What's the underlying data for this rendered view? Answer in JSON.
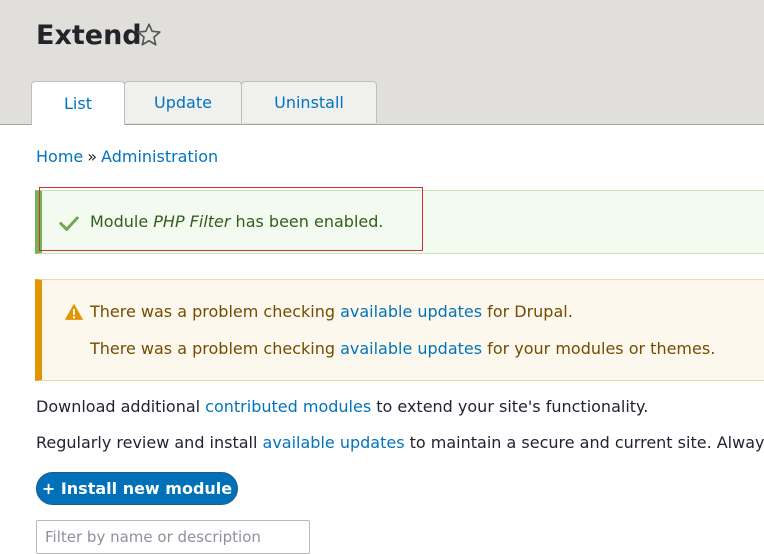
{
  "header": {
    "title": "Extend",
    "tabs": [
      {
        "label": "List"
      },
      {
        "label": "Update"
      },
      {
        "label": "Uninstall"
      }
    ]
  },
  "breadcrumb": {
    "home": "Home",
    "separator": "»",
    "admin": "Administration"
  },
  "status": {
    "prefix": "Module ",
    "module_name": "PHP Filter",
    "suffix": " has been enabled."
  },
  "warning": {
    "line1_prefix": "There was a problem checking ",
    "line1_link": "available updates",
    "line1_suffix": " for Drupal.",
    "line2_prefix": "There was a problem checking ",
    "line2_link": "available updates",
    "line2_suffix": " for your modules or themes."
  },
  "content": {
    "para1_prefix": "Download additional ",
    "para1_link": "contributed modules",
    "para1_suffix": " to extend your site's functionality.",
    "para2_prefix": "Regularly review and install ",
    "para2_link": "available updates",
    "para2_suffix": " to maintain a secure and current site. Always r",
    "install_button": "+ Install new module",
    "filter_placeholder": "Filter by name or description"
  },
  "colors": {
    "link": "#0074bd",
    "status_border": "#77b259",
    "warning_border": "#e09600",
    "button": "#0071b8"
  }
}
